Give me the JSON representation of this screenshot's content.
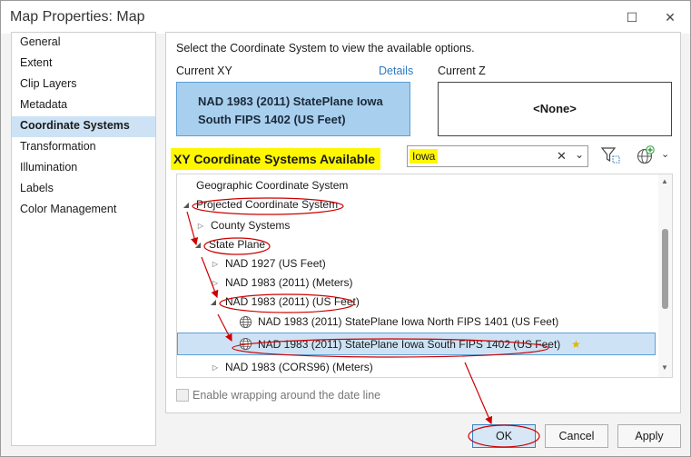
{
  "window": {
    "title": "Map Properties: Map"
  },
  "sidebar": {
    "items": [
      {
        "label": "General"
      },
      {
        "label": "Extent"
      },
      {
        "label": "Clip Layers"
      },
      {
        "label": "Metadata"
      },
      {
        "label": "Coordinate Systems",
        "active": true
      },
      {
        "label": "Transformation"
      },
      {
        "label": "Illumination"
      },
      {
        "label": "Labels"
      },
      {
        "label": "Color Management"
      }
    ]
  },
  "main": {
    "instruction": "Select the Coordinate System to view the available options.",
    "current_xy": {
      "label": "Current XY",
      "details_link": "Details",
      "line1": "NAD 1983 (2011) StatePlane Iowa",
      "line2": "South FIPS 1402 (US Feet)"
    },
    "current_z": {
      "label": "Current Z",
      "value": "<None>"
    },
    "available_title": "XY Coordinate Systems Available",
    "search": {
      "value": "Iowa",
      "clear": "✕",
      "dropdown": "⌄"
    },
    "tree": [
      {
        "label": "Geographic Coordinate System",
        "expanded": null
      },
      {
        "label": "Projected Coordinate System",
        "expanded": true
      },
      {
        "label": "County Systems",
        "expanded": false
      },
      {
        "label": "State Plane",
        "expanded": true
      },
      {
        "label": "NAD 1927 (US Feet)",
        "expanded": false
      },
      {
        "label": "NAD 1983 (2011) (Meters)",
        "expanded": false
      },
      {
        "label": "NAD 1983 (2011) (US Feet)",
        "expanded": true
      },
      {
        "label": "NAD 1983 (2011) StatePlane Iowa North FIPS 1401 (US Feet)",
        "leaf": true
      },
      {
        "label": "NAD 1983 (2011) StatePlane Iowa South FIPS 1402 (US Feet)",
        "leaf": true,
        "selected": true
      },
      {
        "label": "NAD 1983 (CORS96) (Meters)",
        "expanded": false
      }
    ],
    "wrap_label": "Enable wrapping around the date line"
  },
  "footer": {
    "ok_label": "OK",
    "cancel_label": "Cancel",
    "apply_label": "Apply"
  },
  "colors": {
    "accent": "#5c9fd6",
    "selection": "#cde3f5",
    "highlight": "#fff700",
    "annotation": "#cc0000"
  }
}
